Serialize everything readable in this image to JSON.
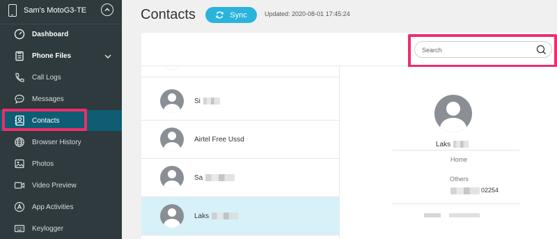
{
  "device": {
    "name": "Sam's MotoG3-TE"
  },
  "sidebar": {
    "items": [
      {
        "label": "Dashboard",
        "icon": "gauge-icon",
        "bold": true
      },
      {
        "label": "Phone Files",
        "icon": "clipboard-icon",
        "bold": true,
        "expandable": true
      },
      {
        "label": "Call Logs",
        "icon": "phone-icon"
      },
      {
        "label": "Messages",
        "icon": "chat-bubble-icon"
      },
      {
        "label": "Contacts",
        "icon": "contact-card-icon",
        "active": true
      },
      {
        "label": "Browser History",
        "icon": "globe-icon"
      },
      {
        "label": "Photos",
        "icon": "image-icon"
      },
      {
        "label": "Video Preview",
        "icon": "video-camera-icon"
      },
      {
        "label": "App Activities",
        "icon": "app-store-icon"
      },
      {
        "label": "Keylogger",
        "icon": "keyboard-icon"
      }
    ]
  },
  "header": {
    "title": "Contacts",
    "sync_label": "Sync",
    "updated": "Updated: 2020-08-01 17:45:24"
  },
  "search": {
    "placeholder": "Search"
  },
  "contacts": [
    {
      "name": ""
    },
    {
      "name": "Si"
    },
    {
      "name": "Airtel Free Ussd"
    },
    {
      "name": "Sa"
    },
    {
      "name": "Laks",
      "selected": true
    }
  ],
  "detail": {
    "name": "Laks",
    "home_label": "Home",
    "others_label": "Others",
    "phone": "02254"
  },
  "colors": {
    "sidebar_bg": "#2f3a3e",
    "active_item": "#0e5d73",
    "accent": "#2ab3db",
    "highlight": "#ef2d6a",
    "selected_row": "#d7f1f8"
  }
}
